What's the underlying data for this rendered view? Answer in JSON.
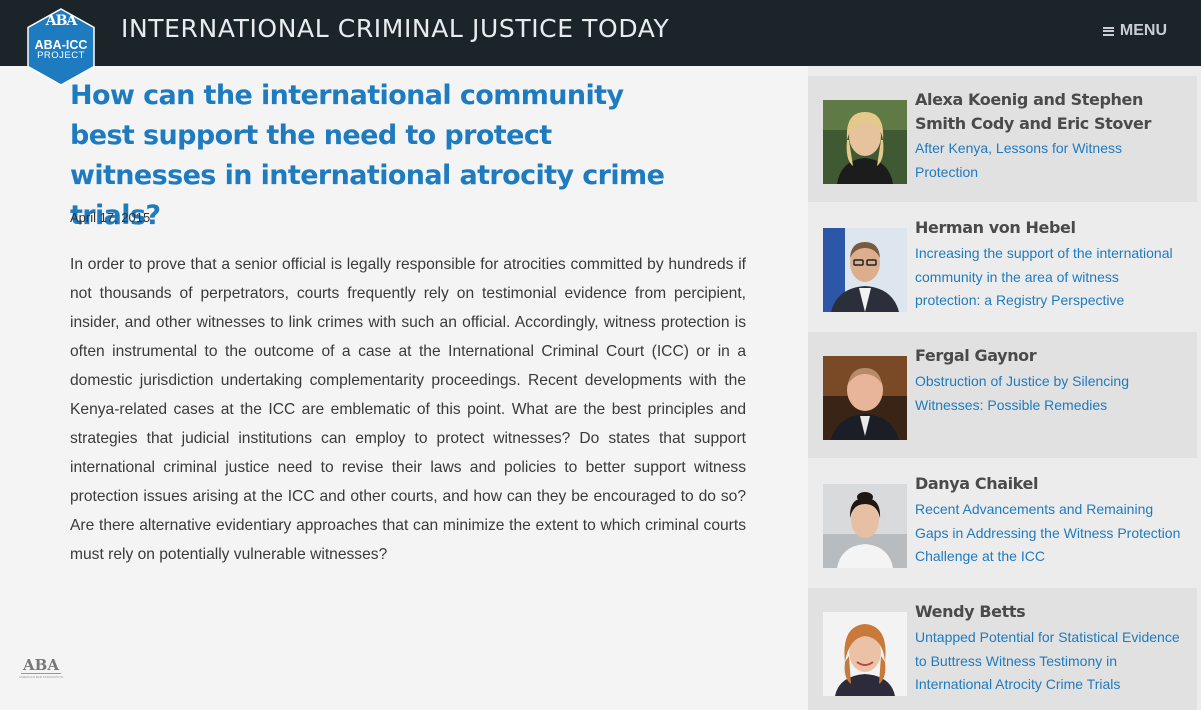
{
  "header": {
    "site_title": "INTERNATIONAL CRIMINAL JUSTICE TODAY",
    "menu_label": "MENU",
    "logo_line1": "ABA-ICC",
    "logo_line2": "PROJECT",
    "logo_aba": "ABA"
  },
  "article": {
    "title": "How can the international community best support the need to protect witnesses in international atrocity crime trials?",
    "date": "April 17, 2015",
    "body": "In order to prove that a senior official is legally responsible for atrocities committed by hundreds if not thousands of perpetrators, courts frequently rely on testimonial evidence from percipient, insider, and other witnesses to link crimes with such an official. Accordingly, witness protection is often instrumental to the outcome of a case at the International Criminal Court (ICC) or in a domestic jurisdiction undertaking complementarity proceedings. Recent developments with the Kenya-related cases at the ICC are emblematic of this point. What are the best principles and strategies that judicial institutions can employ to protect witnesses? Do states that support international criminal justice need to revise their laws and policies to better support witness protection issues arising at the ICC and other courts, and how can they be encouraged to do so? Are there alternative evidentiary approaches that can minimize the extent to which criminal courts must rely on potentially vulnerable witnesses?"
  },
  "footer": {
    "logo_text": "ABA",
    "logo_caption": "AMERICAN BAR ASSOCIATION"
  },
  "sidebar": {
    "items": [
      {
        "name": "Alexa Koenig and Stephen Smith Cody and Eric Stover",
        "link": "After Kenya, Lessons for Witness Protection"
      },
      {
        "name": "Herman von Hebel",
        "link": "Increasing the support of the international community in the area of witness protection: a Registry Perspective"
      },
      {
        "name": "Fergal Gaynor",
        "link": "Obstruction of Justice by Silencing Witnesses: Possible Remedies"
      },
      {
        "name": "Danya Chaikel",
        "link": "Recent Advancements and Remaining Gaps in Addressing the Witness Protection Challenge at the ICC"
      },
      {
        "name": "Wendy Betts",
        "link": "Untapped Potential for Statistical Evidence to Buttress Witness Testimony in International Atrocity Crime Trials"
      }
    ]
  },
  "colors": {
    "header_bg": "#1b2428",
    "logo_blue": "#1f7bbf",
    "title_blue": "#1f7bbf",
    "link_blue": "#1f7bbf",
    "sidebar_bg": "#ececec",
    "sidebar_card_shade": "#e1e1e1"
  }
}
